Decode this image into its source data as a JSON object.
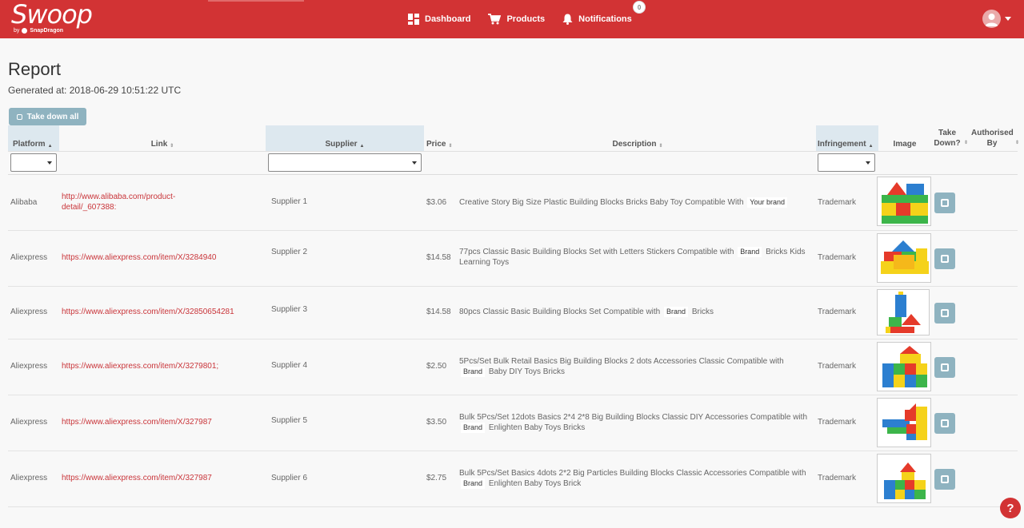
{
  "nav": {
    "logo": "Swoop",
    "logo_by": "by",
    "logo_company": "SnapDragon",
    "dashboard": "Dashboard",
    "products": "Products",
    "notifications": "Notifications",
    "notif_count": "0"
  },
  "page": {
    "title": "Report",
    "generated": "Generated at: 2018-06-29 10:51:22 UTC",
    "takedown_all": "Take down all"
  },
  "table": {
    "headers": {
      "platform": "Platform",
      "link": "Link",
      "supplier": "Supplier",
      "price": "Price",
      "description": "Description",
      "infringement": "Infringement",
      "image": "Image",
      "takedown": "Take Down?",
      "authorised": "Authorised By"
    },
    "rows": [
      {
        "platform": "Alibaba",
        "link": "http://www.alibaba.com/product-detail/_607388:",
        "supplier": "Supplier 1",
        "price": "$3.06",
        "desc_pre": "Creative Story Big Size Plastic Building Blocks Bricks Baby Toy Compatible With",
        "brand": "Your brand",
        "desc_post": "",
        "infringement": "Trademark"
      },
      {
        "platform": "Aliexpress",
        "link": "https://www.aliexpress.com/item/X/3284940",
        "supplier": "Supplier 2",
        "price": "$14.58",
        "desc_pre": "77pcs Classic Basic Building Blocks Set with Letters Stickers Compatible with",
        "brand": "Brand",
        "desc_post": "Bricks Kids Learning Toys",
        "infringement": "Trademark"
      },
      {
        "platform": "Aliexpress",
        "link": "https://www.aliexpress.com/item/X/32850654281",
        "supplier": "Supplier 3",
        "price": "$14.58",
        "desc_pre": "80pcs Classic Basic Building Blocks Set Compatible with",
        "brand": "Brand",
        "desc_post": "Bricks",
        "infringement": "Trademark"
      },
      {
        "platform": "Aliexpress",
        "link": "https://www.aliexpress.com/item/X/3279801;",
        "supplier": "Supplier 4",
        "price": "$2.50",
        "desc_pre": "5Pcs/Set Bulk Retail Basics Big Building Blocks 2 dots Accessories Classic Compatible with",
        "brand": "Brand",
        "desc_post": "Baby DIY Toys Bricks",
        "infringement": "Trademark"
      },
      {
        "platform": "Aliexpress",
        "link": "https://www.aliexpress.com/item/X/327987",
        "supplier": "Supplier 5",
        "price": "$3.50",
        "desc_pre": "Bulk 5Pcs/Set 12dots Basics 2*4 2*8 Big Building Blocks Classic DIY Accessories Compatible with",
        "brand": "Brand",
        "desc_post": "Enlighten Baby Toys Bricks",
        "infringement": "Trademark"
      },
      {
        "platform": "Aliexpress",
        "link": "https://www.aliexpress.com/item/X/327987",
        "supplier": "Supplier 6",
        "price": "$2.75",
        "desc_pre": "Bulk 5Pcs/Set Basics 4dots 2*2 Big Particles Building Blocks Classic Accessories Compatible with",
        "brand": "Brand",
        "desc_post": "Enlighten Baby Toys Brick",
        "infringement": "Trademark"
      }
    ]
  },
  "help": "?",
  "colors": {
    "brand_red": "#d23334",
    "button_blue": "#8fb3c0",
    "link_red": "#c9353a"
  }
}
